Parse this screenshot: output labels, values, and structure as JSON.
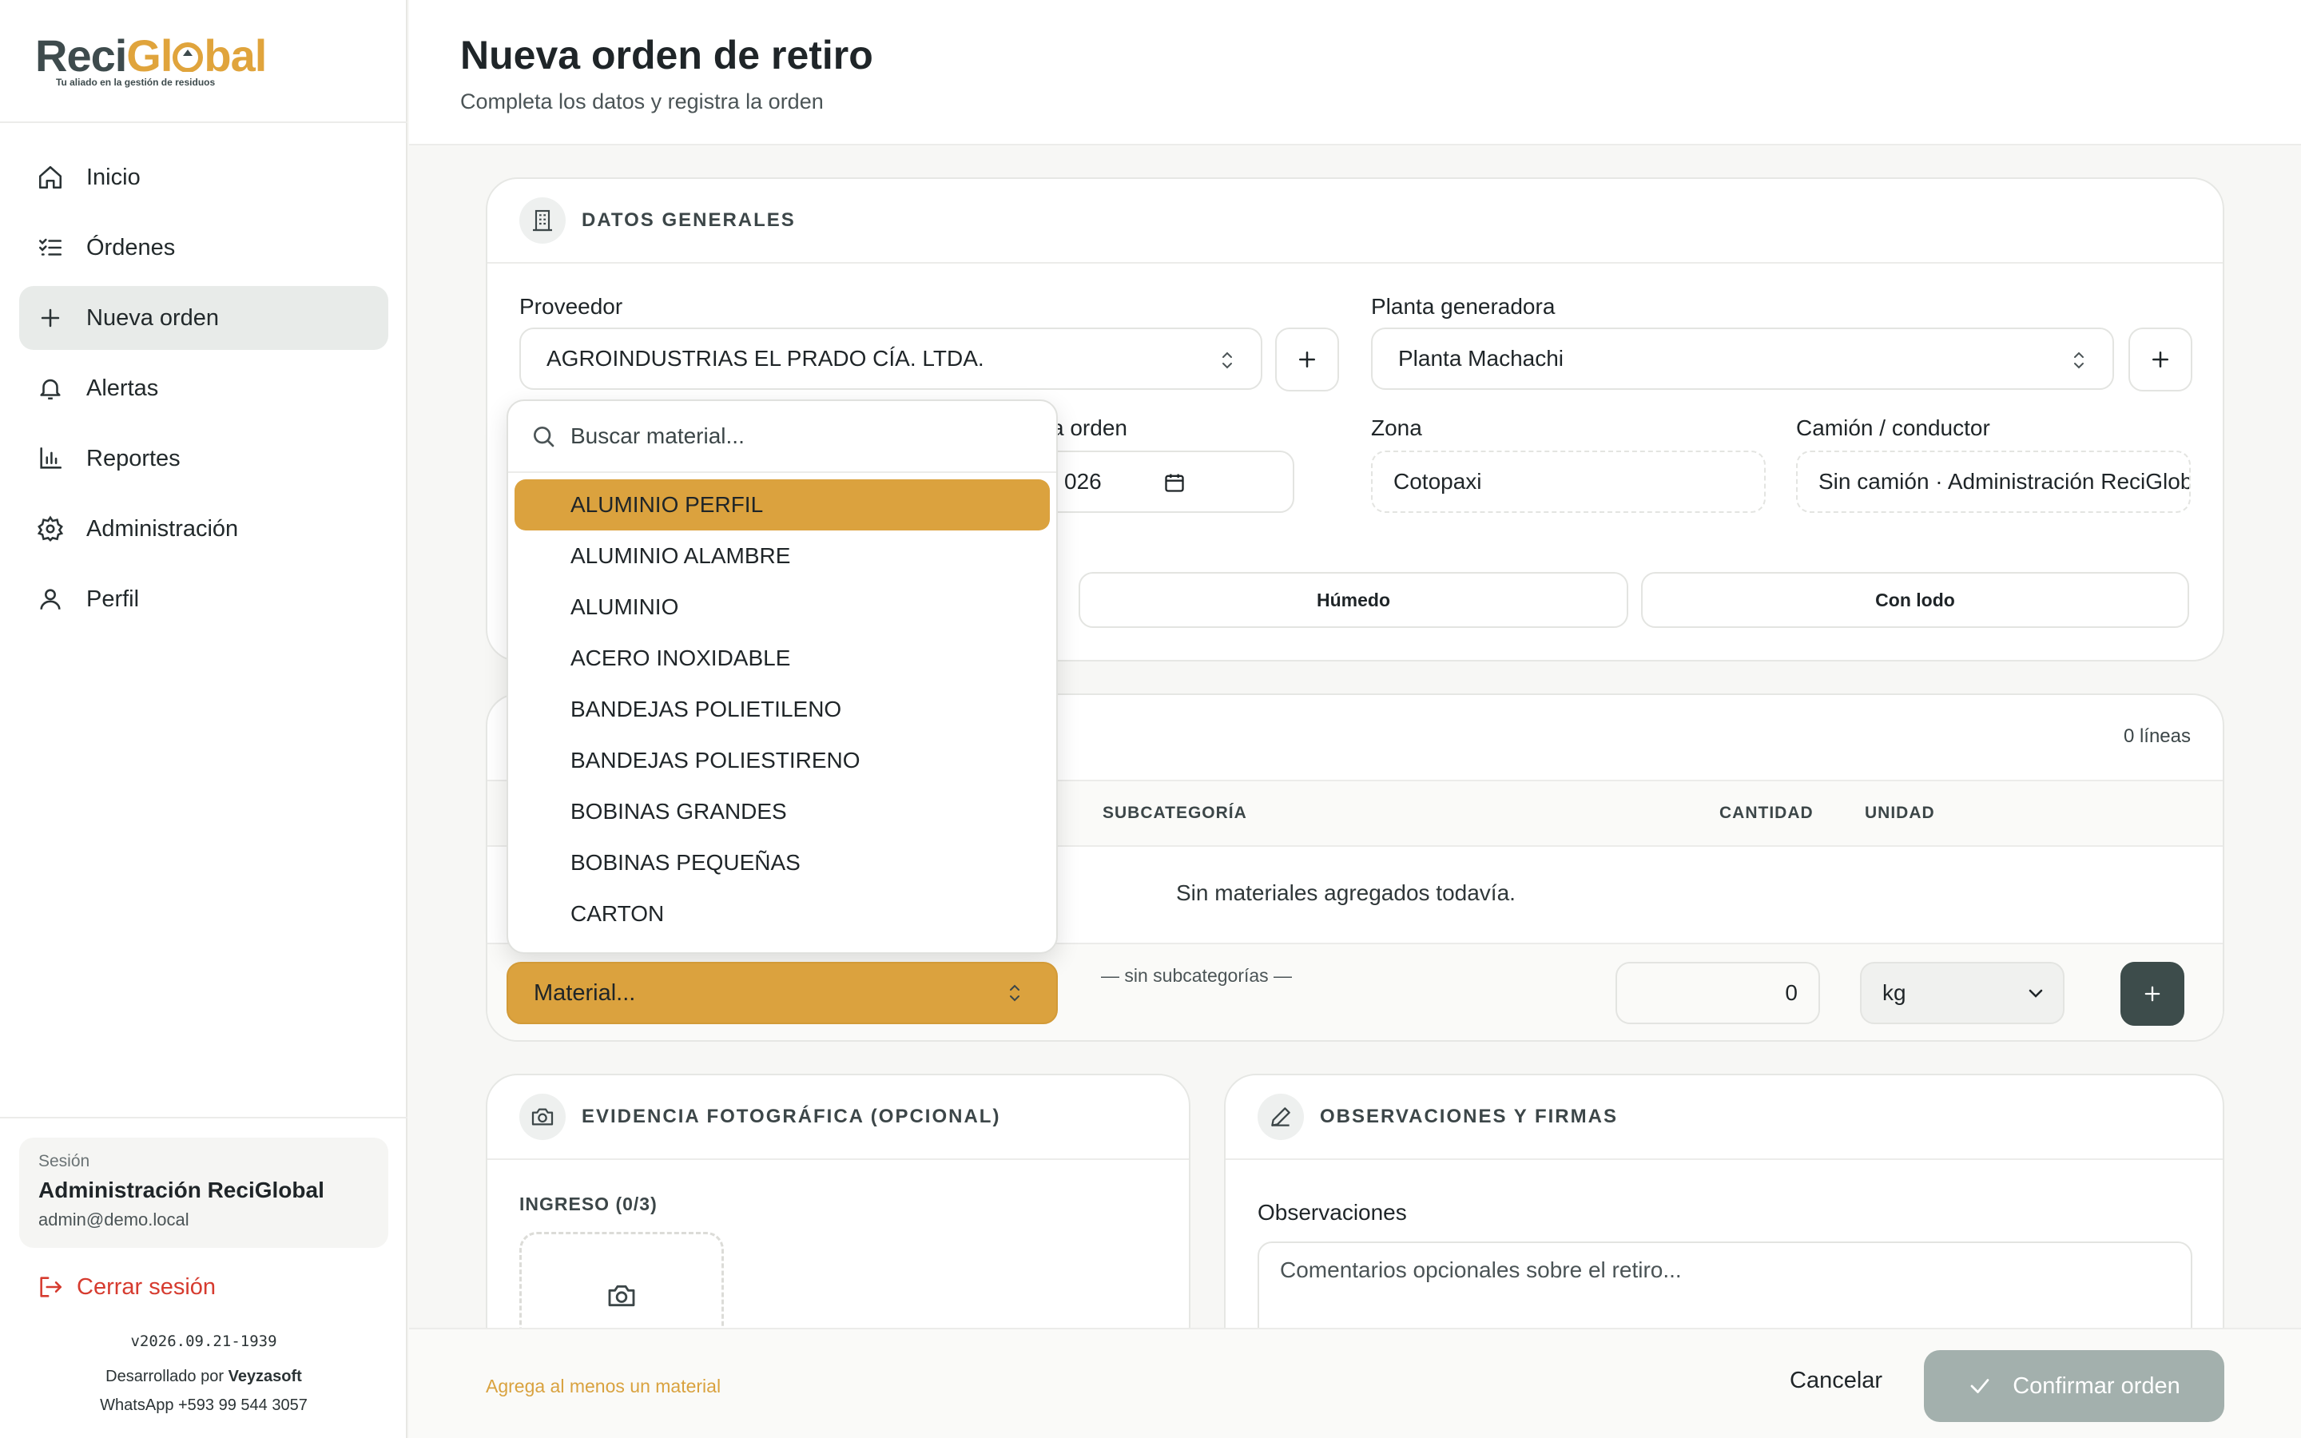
{
  "brand": {
    "logo_part1": "Reci",
    "logo_part2": "Gl",
    "logo_part3": "bal",
    "tagline": "Tu aliado en la gestión de residuos",
    "accent": "#dba23e",
    "dark": "#3e4b4d"
  },
  "nav": {
    "items": [
      {
        "label": "Inicio",
        "icon": "home-icon"
      },
      {
        "label": "Órdenes",
        "icon": "list-check-icon"
      },
      {
        "label": "Nueva orden",
        "icon": "plus-icon",
        "active": true
      },
      {
        "label": "Alertas",
        "icon": "bell-icon"
      },
      {
        "label": "Reportes",
        "icon": "bar-chart-icon"
      },
      {
        "label": "Administración",
        "icon": "gear-icon"
      },
      {
        "label": "Perfil",
        "icon": "user-icon"
      }
    ]
  },
  "session": {
    "label": "Sesión",
    "name": "Administración ReciGlobal",
    "email": "admin@demo.local",
    "logout": "Cerrar sesión"
  },
  "meta": {
    "version": "v2026.09.21-1939",
    "dev_prefix": "Desarrollado por ",
    "dev_name": "Veyzasoft",
    "whatsapp": "WhatsApp +593 99 544 3057"
  },
  "header": {
    "title": "Nueva orden de retiro",
    "subtitle": "Completa los datos y registra la orden"
  },
  "general": {
    "title": "DATOS GENERALES",
    "proveedor_label": "Proveedor",
    "proveedor_value": "AGROINDUSTRIAS EL PRADO CÍA. LTDA.",
    "planta_label": "Planta generadora",
    "planta_value": "Planta Machachi",
    "fecha_label": "a orden",
    "fecha_value": "026",
    "zona_label": "Zona",
    "zona_value": "Cotopaxi",
    "camion_label": "Camión / conductor",
    "camion_value": "Sin camión · Administración ReciGlobal",
    "toggle_humedo": "Húmedo",
    "toggle_lodo": "Con lodo"
  },
  "materials": {
    "lines": "0 líneas",
    "col_subcat": "SUBCATEGORÍA",
    "col_cantidad": "CANTIDAD",
    "col_unidad": "UNIDAD",
    "empty": "Sin materiales agregados todavía.",
    "material_placeholder": "Material...",
    "no_subcat": "— sin subcategorías —",
    "qty": "0",
    "unit": "kg",
    "search_placeholder": "Buscar material...",
    "options": [
      "ALUMINIO PERFIL",
      "ALUMINIO ALAMBRE",
      "ALUMINIO",
      "ACERO INOXIDABLE",
      "BANDEJAS POLIETILENO",
      "BANDEJAS POLIESTIRENO",
      "BOBINAS GRANDES",
      "BOBINAS PEQUEÑAS",
      "CARTON"
    ],
    "selected_index": 0
  },
  "evidence": {
    "title": "EVIDENCIA FOTOGRÁFICA (OPCIONAL)",
    "ingreso": "INGRESO (0/3)"
  },
  "observations": {
    "title": "OBSERVACIONES Y FIRMAS",
    "label": "Observaciones",
    "placeholder": "Comentarios opcionales sobre el retiro..."
  },
  "footer": {
    "hint": "Agrega al menos un material",
    "cancel": "Cancelar",
    "confirm": "Confirmar orden"
  }
}
